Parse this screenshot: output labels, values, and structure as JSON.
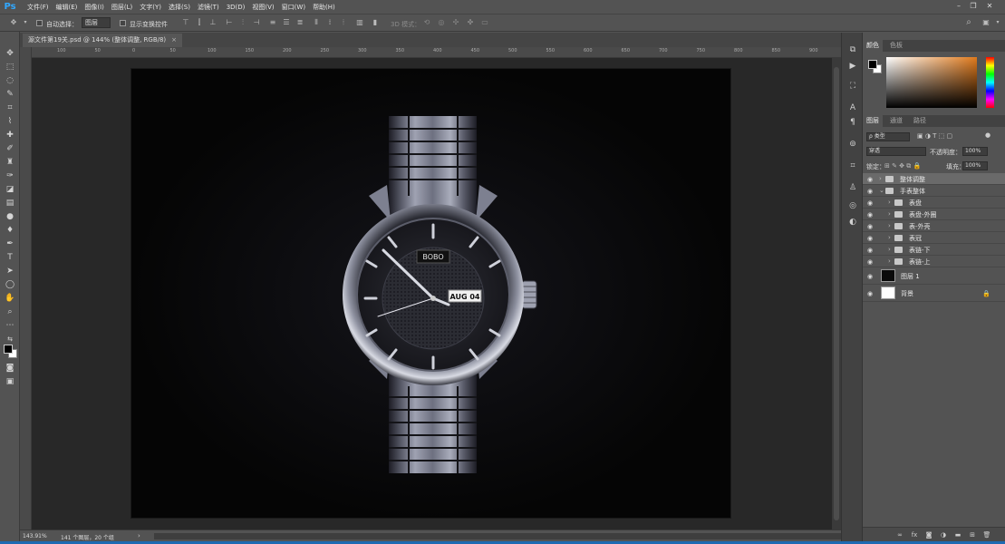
{
  "app": {
    "logo": "Ps"
  },
  "menu": [
    "文件(F)",
    "编辑(E)",
    "图像(I)",
    "图层(L)",
    "文字(Y)",
    "选择(S)",
    "滤镜(T)",
    "3D(D)",
    "视图(V)",
    "窗口(W)",
    "帮助(H)"
  ],
  "options": {
    "auto_select_label": "自动选择：",
    "auto_select_value": "图层",
    "show_transform_label": "显示变换控件",
    "mode_3d_label": "3D 模式："
  },
  "document": {
    "tab_title": "源文件第19关.psd @ 144% (整体调整, RGB/8)",
    "close_glyph": "×"
  },
  "ruler_ticks": [
    "100",
    "50",
    "0",
    "50",
    "100",
    "150",
    "200",
    "250",
    "300",
    "350",
    "400",
    "450",
    "500",
    "550",
    "600",
    "650",
    "700",
    "750",
    "800",
    "850",
    "900"
  ],
  "status": {
    "zoom": "143.91%",
    "info": "141 个图层，20 个组",
    "arrow": "›"
  },
  "watch": {
    "brand": "BOBO",
    "date": "AUG 04"
  },
  "color_panel": {
    "tabs": [
      "颜色",
      "色板"
    ]
  },
  "layers_panel": {
    "tabs": [
      "图层",
      "通道",
      "路径"
    ],
    "filter_label": "ρ 类型",
    "blend_mode": "穿透",
    "opacity_label": "不透明度：",
    "opacity_value": "100%",
    "lock_label": "锁定：",
    "fill_label": "填充：",
    "fill_value": "100%",
    "layers": [
      {
        "name": "整体调整"
      },
      {
        "name": "手表整体"
      },
      {
        "name": "表盘"
      },
      {
        "name": "表盘-外圈"
      },
      {
        "name": "表-外壳"
      },
      {
        "name": "表冠"
      },
      {
        "name": "表链-下"
      },
      {
        "name": "表链-上"
      },
      {
        "name": "图层 1"
      },
      {
        "name": "背景"
      }
    ]
  },
  "colors": {
    "ps_blue": "#31a8ff",
    "panel_bg": "#535353",
    "canvas_bg": "#050505",
    "selected_layer": "#6a6a6a"
  }
}
